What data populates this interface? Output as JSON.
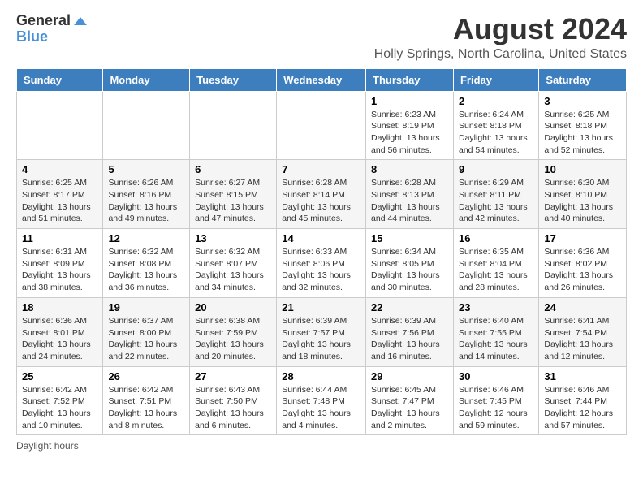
{
  "logo": {
    "general": "General",
    "blue": "Blue"
  },
  "title": "August 2024",
  "location": "Holly Springs, North Carolina, United States",
  "days_of_week": [
    "Sunday",
    "Monday",
    "Tuesday",
    "Wednesday",
    "Thursday",
    "Friday",
    "Saturday"
  ],
  "weeks": [
    [
      {
        "day": "",
        "info": ""
      },
      {
        "day": "",
        "info": ""
      },
      {
        "day": "",
        "info": ""
      },
      {
        "day": "",
        "info": ""
      },
      {
        "day": "1",
        "info": "Sunrise: 6:23 AM\nSunset: 8:19 PM\nDaylight: 13 hours and 56 minutes."
      },
      {
        "day": "2",
        "info": "Sunrise: 6:24 AM\nSunset: 8:18 PM\nDaylight: 13 hours and 54 minutes."
      },
      {
        "day": "3",
        "info": "Sunrise: 6:25 AM\nSunset: 8:18 PM\nDaylight: 13 hours and 52 minutes."
      }
    ],
    [
      {
        "day": "4",
        "info": "Sunrise: 6:25 AM\nSunset: 8:17 PM\nDaylight: 13 hours and 51 minutes."
      },
      {
        "day": "5",
        "info": "Sunrise: 6:26 AM\nSunset: 8:16 PM\nDaylight: 13 hours and 49 minutes."
      },
      {
        "day": "6",
        "info": "Sunrise: 6:27 AM\nSunset: 8:15 PM\nDaylight: 13 hours and 47 minutes."
      },
      {
        "day": "7",
        "info": "Sunrise: 6:28 AM\nSunset: 8:14 PM\nDaylight: 13 hours and 45 minutes."
      },
      {
        "day": "8",
        "info": "Sunrise: 6:28 AM\nSunset: 8:13 PM\nDaylight: 13 hours and 44 minutes."
      },
      {
        "day": "9",
        "info": "Sunrise: 6:29 AM\nSunset: 8:11 PM\nDaylight: 13 hours and 42 minutes."
      },
      {
        "day": "10",
        "info": "Sunrise: 6:30 AM\nSunset: 8:10 PM\nDaylight: 13 hours and 40 minutes."
      }
    ],
    [
      {
        "day": "11",
        "info": "Sunrise: 6:31 AM\nSunset: 8:09 PM\nDaylight: 13 hours and 38 minutes."
      },
      {
        "day": "12",
        "info": "Sunrise: 6:32 AM\nSunset: 8:08 PM\nDaylight: 13 hours and 36 minutes."
      },
      {
        "day": "13",
        "info": "Sunrise: 6:32 AM\nSunset: 8:07 PM\nDaylight: 13 hours and 34 minutes."
      },
      {
        "day": "14",
        "info": "Sunrise: 6:33 AM\nSunset: 8:06 PM\nDaylight: 13 hours and 32 minutes."
      },
      {
        "day": "15",
        "info": "Sunrise: 6:34 AM\nSunset: 8:05 PM\nDaylight: 13 hours and 30 minutes."
      },
      {
        "day": "16",
        "info": "Sunrise: 6:35 AM\nSunset: 8:04 PM\nDaylight: 13 hours and 28 minutes."
      },
      {
        "day": "17",
        "info": "Sunrise: 6:36 AM\nSunset: 8:02 PM\nDaylight: 13 hours and 26 minutes."
      }
    ],
    [
      {
        "day": "18",
        "info": "Sunrise: 6:36 AM\nSunset: 8:01 PM\nDaylight: 13 hours and 24 minutes."
      },
      {
        "day": "19",
        "info": "Sunrise: 6:37 AM\nSunset: 8:00 PM\nDaylight: 13 hours and 22 minutes."
      },
      {
        "day": "20",
        "info": "Sunrise: 6:38 AM\nSunset: 7:59 PM\nDaylight: 13 hours and 20 minutes."
      },
      {
        "day": "21",
        "info": "Sunrise: 6:39 AM\nSunset: 7:57 PM\nDaylight: 13 hours and 18 minutes."
      },
      {
        "day": "22",
        "info": "Sunrise: 6:39 AM\nSunset: 7:56 PM\nDaylight: 13 hours and 16 minutes."
      },
      {
        "day": "23",
        "info": "Sunrise: 6:40 AM\nSunset: 7:55 PM\nDaylight: 13 hours and 14 minutes."
      },
      {
        "day": "24",
        "info": "Sunrise: 6:41 AM\nSunset: 7:54 PM\nDaylight: 13 hours and 12 minutes."
      }
    ],
    [
      {
        "day": "25",
        "info": "Sunrise: 6:42 AM\nSunset: 7:52 PM\nDaylight: 13 hours and 10 minutes."
      },
      {
        "day": "26",
        "info": "Sunrise: 6:42 AM\nSunset: 7:51 PM\nDaylight: 13 hours and 8 minutes."
      },
      {
        "day": "27",
        "info": "Sunrise: 6:43 AM\nSunset: 7:50 PM\nDaylight: 13 hours and 6 minutes."
      },
      {
        "day": "28",
        "info": "Sunrise: 6:44 AM\nSunset: 7:48 PM\nDaylight: 13 hours and 4 minutes."
      },
      {
        "day": "29",
        "info": "Sunrise: 6:45 AM\nSunset: 7:47 PM\nDaylight: 13 hours and 2 minutes."
      },
      {
        "day": "30",
        "info": "Sunrise: 6:46 AM\nSunset: 7:45 PM\nDaylight: 12 hours and 59 minutes."
      },
      {
        "day": "31",
        "info": "Sunrise: 6:46 AM\nSunset: 7:44 PM\nDaylight: 12 hours and 57 minutes."
      }
    ]
  ],
  "footer": "Daylight hours"
}
